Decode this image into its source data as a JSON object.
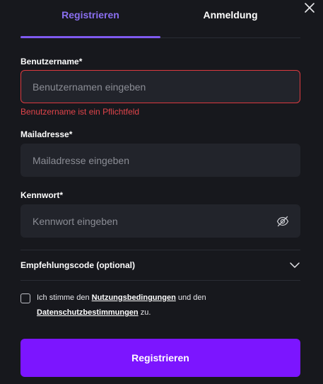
{
  "tabs": {
    "register": "Registrieren",
    "login": "Anmeldung"
  },
  "username": {
    "label": "Benutzername*",
    "placeholder": "Benutzernamen eingeben",
    "value": "",
    "error": "Benutzername ist ein Pflichtfeld"
  },
  "email": {
    "label": "Mailadresse*",
    "placeholder": "Mailadresse eingeben",
    "value": ""
  },
  "password": {
    "label": "Kennwort*",
    "placeholder": "Kennwort eingeben",
    "value": ""
  },
  "referral": {
    "label": "Empfehlungscode (optional)"
  },
  "terms": {
    "checked": false,
    "text_1": "Ich stimme den ",
    "link_terms": "Nutzungsbedingungen",
    "text_2": " und den ",
    "link_privacy": "Datenschutzbestimmungen",
    "text_3": " zu."
  },
  "submit_label": "Registrieren",
  "icons": {
    "close": "close-icon",
    "password_toggle": "eye-slash-icon",
    "referral_toggle": "chevron-down-icon"
  },
  "colors": {
    "background": "#17181d",
    "field": "#22242b",
    "accent": "#7f5af0",
    "button": "#7c15ff",
    "error": "#e0444a"
  }
}
